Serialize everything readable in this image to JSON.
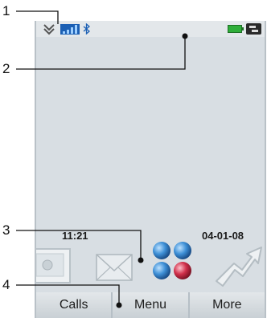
{
  "status_bar": {
    "icons": [
      "chevron-down-icon",
      "signal-strength-icon",
      "bluetooth-icon",
      "battery-icon",
      "charger-icon"
    ]
  },
  "standby": {
    "time": "11:21",
    "date": "04-01-08"
  },
  "dock": {
    "icons": [
      "photo-icon",
      "mail-icon",
      "application-menu-icon",
      "arrow-icon"
    ]
  },
  "softkeys": {
    "left": "Calls",
    "center": "Menu",
    "right": "More"
  },
  "callouts": [
    "1",
    "2",
    "3",
    "4"
  ],
  "colors": {
    "screen_bg": "#d8dee3",
    "signal": "#1b5fb4",
    "battery": "#2fae3a",
    "softkey_bg": "#dfe4e7"
  }
}
